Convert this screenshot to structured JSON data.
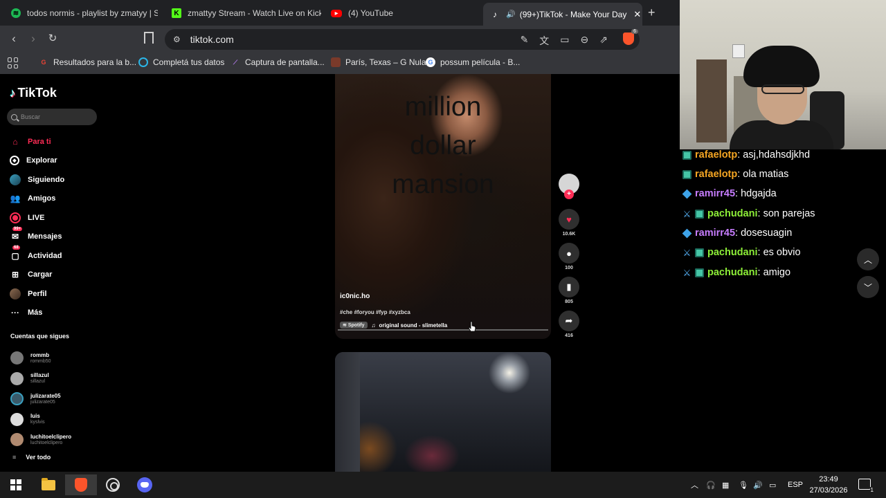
{
  "browser": {
    "tabs": [
      {
        "label": "todos normis - playlist by zmatyy | Sp",
        "icon": "spotify-icon",
        "color": "#1db954"
      },
      {
        "label": "zmattyy Stream - Watch Live on Kick",
        "icon": "kick-icon",
        "color": "#53fc18"
      },
      {
        "label": "(4) YouTube",
        "icon": "youtube-icon",
        "color": "#ff0000"
      },
      {
        "label": "(99+)TikTok - Make Your Day",
        "icon": "tiktok-icon",
        "color": "#ffffff",
        "active": true
      }
    ],
    "url": "tiktok.com",
    "shield_badge": "6",
    "bookmarks": [
      {
        "label": "Resultados para la b...",
        "icon": "google-icon"
      },
      {
        "label": "Completá tus datos",
        "icon": "circle-icon"
      },
      {
        "label": "Captura de pantalla...",
        "icon": "feather-icon"
      },
      {
        "label": "París, Texas – G Nula",
        "icon": "movie-icon"
      },
      {
        "label": "possum película - B...",
        "icon": "google-icon"
      }
    ]
  },
  "tiktok": {
    "logo": "TikTok",
    "search_placeholder": "Buscar",
    "nav": [
      {
        "label": "Para ti",
        "icon": "home-icon",
        "active": true
      },
      {
        "label": "Explorar",
        "icon": "compass-icon"
      },
      {
        "label": "Siguiendo",
        "icon": "following-icon"
      },
      {
        "label": "Amigos",
        "icon": "friends-icon"
      },
      {
        "label": "LIVE",
        "icon": "live-icon"
      },
      {
        "label": "Mensajes",
        "icon": "messages-icon",
        "badge": "99+"
      },
      {
        "label": "Actividad",
        "icon": "activity-icon",
        "badge": "68"
      },
      {
        "label": "Cargar",
        "icon": "upload-icon"
      },
      {
        "label": "Perfil",
        "icon": "profile-icon"
      },
      {
        "label": "Más",
        "icon": "more-icon"
      }
    ],
    "following_title": "Cuentas que sigues",
    "following": [
      {
        "name": "rommb",
        "handle": "rommb50"
      },
      {
        "name": "sillazul",
        "handle": "sillazul"
      },
      {
        "name": "julizarate05",
        "handle": "julizarate05"
      },
      {
        "name": "luis",
        "handle": "kyslvis"
      },
      {
        "name": "luchitoelclipero",
        "handle": "luchitoelclipero"
      }
    ],
    "see_all": "Ver todo",
    "video": {
      "overlay_lines": [
        "million",
        "dollar",
        "mansion"
      ],
      "author": "ic0nic.ho",
      "tags": "#che #foryou #fyp #xyzbca",
      "spotify_label": "Spotify",
      "sound": "original sound - slimetella",
      "likes": "10.6K",
      "comments": "100",
      "saves": "805",
      "shares": "416"
    }
  },
  "chat": [
    {
      "user": "rafaelotp",
      "text": ": asj,hdahsdjkhd",
      "color": "#f5a623",
      "badges": [
        "sub"
      ]
    },
    {
      "user": "rafaelotp",
      "text": ": ola matias",
      "color": "#f5a623",
      "badges": [
        "sub"
      ]
    },
    {
      "user": "ramirr45",
      "text": ": hdgajda",
      "color": "#c77dff",
      "badges": [
        "gem"
      ]
    },
    {
      "user": "pachudani",
      "text": ": son parejas",
      "color": "#8dee38",
      "badges": [
        "sword",
        "sub"
      ]
    },
    {
      "user": "ramirr45",
      "text": ": dosesuagin",
      "color": "#c77dff",
      "badges": [
        "gem"
      ]
    },
    {
      "user": "pachudani",
      "text": ": es obvio",
      "color": "#8dee38",
      "badges": [
        "sword",
        "sub"
      ]
    },
    {
      "user": "pachudani",
      "text": ": amigo",
      "color": "#8dee38",
      "badges": [
        "sword",
        "sub"
      ]
    }
  ],
  "taskbar": {
    "language": "ESP",
    "time": "23:49",
    "date": "27/03/2026",
    "notifications": "1"
  }
}
